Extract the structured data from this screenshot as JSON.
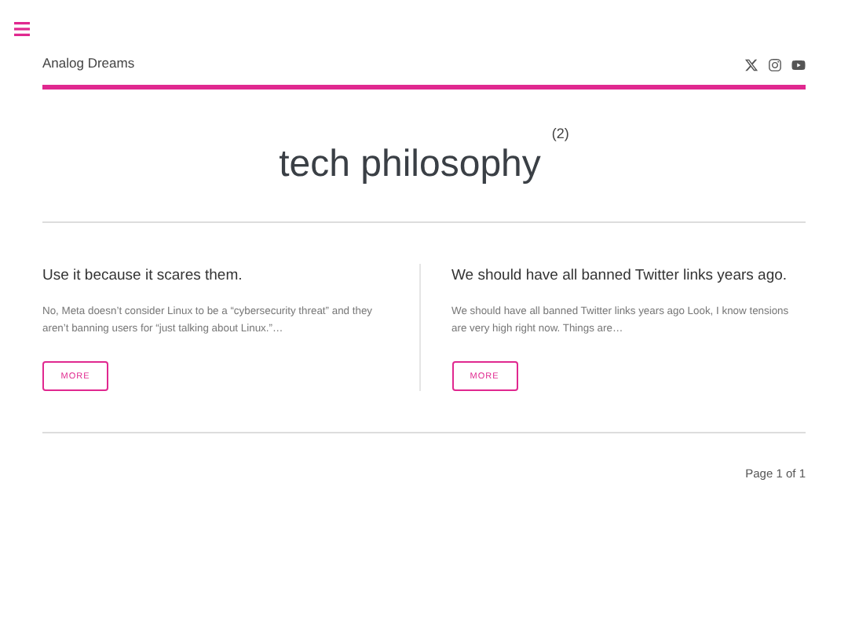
{
  "site_title": "Analog Dreams",
  "social_links": [
    {
      "kind": "x"
    },
    {
      "kind": "camera"
    },
    {
      "kind": "play"
    }
  ],
  "heading": {
    "title": "tech philosophy",
    "count": "(2)"
  },
  "posts": [
    {
      "title": "Use it because it scares them.",
      "excerpt": "No, Meta doesn’t consider Linux to be a “cybersecurity threat” and they aren’t banning users for “just talking about Linux.”…",
      "button": "MORE"
    },
    {
      "title": "We should have all banned Twitter links years ago.",
      "excerpt": "We should have all banned Twitter links years ago Look, I know tensions are very high right now. Things are…",
      "button": "MORE"
    }
  ],
  "pagination": "Page 1 of 1"
}
